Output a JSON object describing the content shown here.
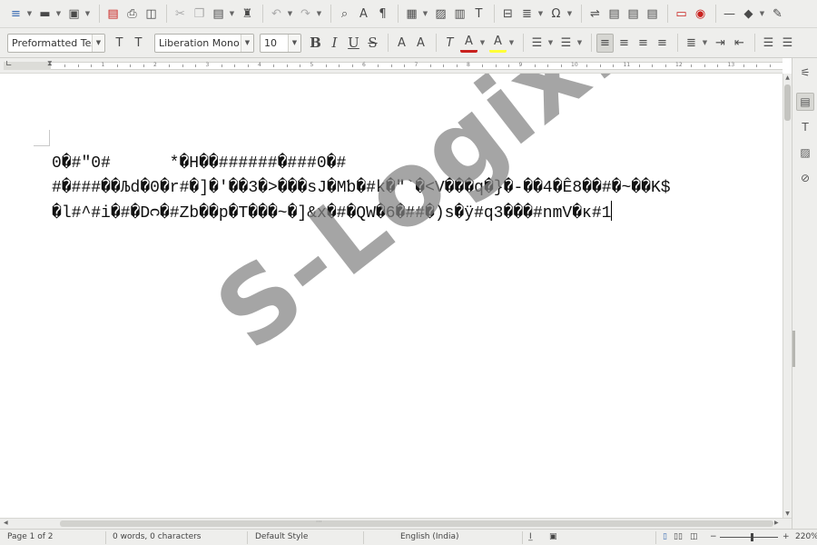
{
  "toolbar": {
    "para_style": "Preformatted Text",
    "font_name": "Liberation Mono",
    "font_size": "10",
    "icons": {
      "new": "≡",
      "open": "▬",
      "save": "▣",
      "export_pdf": "▤",
      "print": "⎙",
      "print_preview": "◫",
      "cut": "✂",
      "copy": "❐",
      "paste": "▤",
      "clone": "♜",
      "undo": "↶",
      "redo": "↷",
      "find": "⌕",
      "spelling": "A",
      "pilcrow": "¶",
      "table": "▦",
      "image": "▨",
      "chart": "▥",
      "textbox": "T",
      "page_break": "⊟",
      "field": "≣",
      "special_char": "Ω",
      "hyperlink": "⇌",
      "footnote": "▤",
      "comment": "▭",
      "track_changes": "◉",
      "line": "—",
      "shapes": "◆",
      "draw": "✎",
      "bold": "B",
      "italic": "I",
      "underline": "U",
      "strike": "S",
      "superscript": "A",
      "subscript": "A",
      "clear_format": "T",
      "font_color": "A",
      "highlight": "A",
      "bullets": "☰",
      "numbering": "☰",
      "align_left": "≡",
      "align_center": "≡",
      "align_right": "≡",
      "justify": "≡",
      "line_spacing": "≣",
      "indent_more": "⇥",
      "indent_less": "⇤",
      "para_above": "☰",
      "para_below": "☰",
      "style_update": "T",
      "style_new": "T"
    },
    "font_color_accent": "#c9211e",
    "highlight_accent": "#ffff38"
  },
  "ruler": {
    "numbers": [
      "1",
      "2",
      "3",
      "4",
      "5",
      "6",
      "7",
      "8",
      "9",
      "10",
      "11",
      "12",
      "13"
    ]
  },
  "document": {
    "lines": [
      "0�#\"0#      *�H��######�###0�#",
      "#�###��Љd�0�r#�]�'��3�>���sJ�Mƅ�#k�\"`�<V���q�}�-��4�Ê8��#�~��K$",
      "�l#^#i�#�Dᴒ�#Zb��p�T���~�]&x�#�QW�6�##�)s�ÿ#q3���#nmV�ĸ#1"
    ]
  },
  "watermark": "S-Logix.in",
  "sidebar": {
    "icons": {
      "properties": "⚟",
      "styles": "▤",
      "gallery": "T",
      "navigator": "▨",
      "compass": "⊘"
    }
  },
  "status": {
    "page": "Page 1 of 2",
    "words": "0 words, 0 characters",
    "style": "Default Style",
    "language": "English (India)",
    "zoom": "220%",
    "zoom_minus": "−",
    "zoom_plus": "+"
  }
}
